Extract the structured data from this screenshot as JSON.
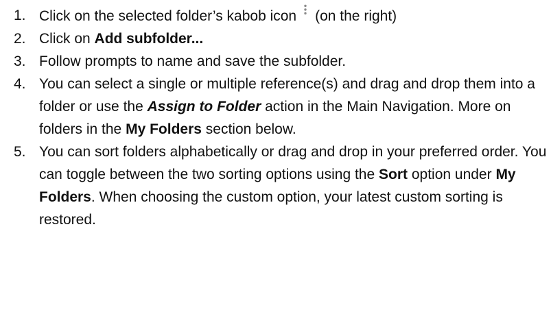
{
  "steps": [
    {
      "number": "1.",
      "text_a": "Click on the selected folder’s kabob icon",
      "icon": "kabob-vertical-dots",
      "text_b": "(on the right)"
    },
    {
      "number": "2.",
      "text_a": "Click on ",
      "bold": "Add subfolder..."
    },
    {
      "number": "3.",
      "text": "Follow prompts to name and save the subfolder."
    },
    {
      "number": "4.",
      "text_a": "You can select a single or multiple reference(s) and drag and drop them into a folder or use the ",
      "bold_italic": "Assign to Folder",
      "text_b": " action in the Main Navigation. More on folders in the ",
      "bold": "My Folders",
      "text_c": " section below."
    },
    {
      "number": "5.",
      "text_a": "You can sort folders alphabetically or drag and drop in your preferred order. You can toggle between the two sorting options using the ",
      "bold_a": "Sort",
      "text_b": " option under ",
      "bold_b": "My Folders",
      "text_c": ". When choosing the custom option, your latest custom sorting is restored."
    }
  ],
  "colors": {
    "text": "#111111",
    "icon": "#8a8a8a"
  }
}
